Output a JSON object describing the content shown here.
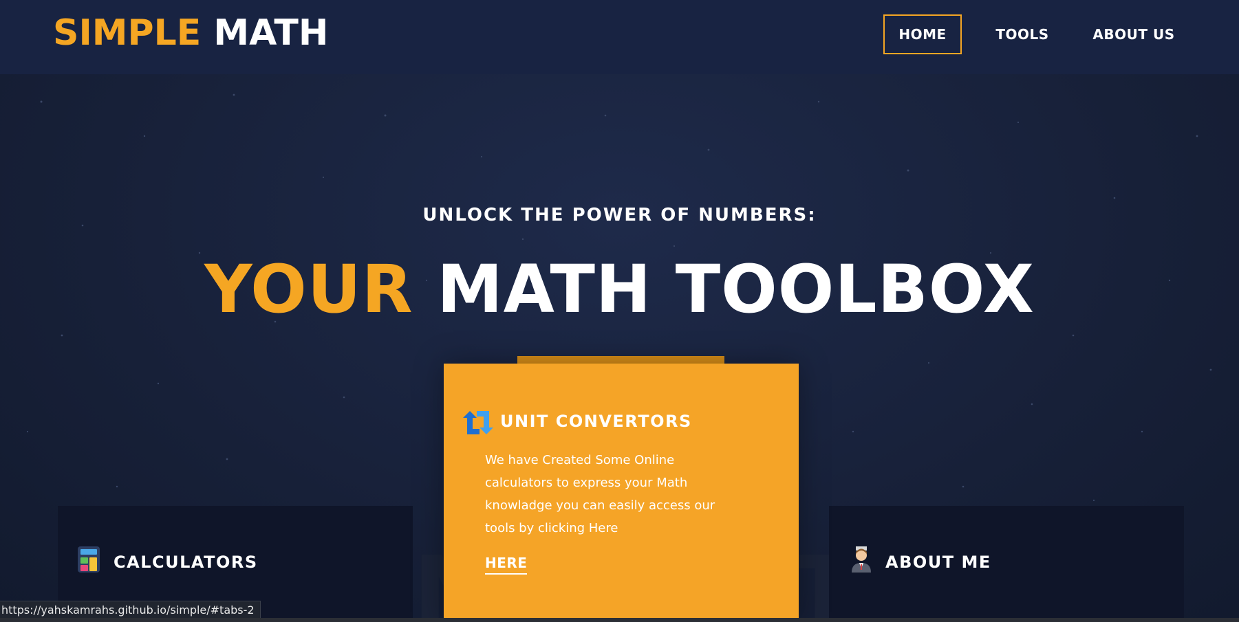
{
  "brand": {
    "part1": "SIMPLE",
    "part2": "MATH"
  },
  "nav": {
    "home": "HOME",
    "tools": "TOOLS",
    "about": "ABOUT US",
    "active": "HOME"
  },
  "hero": {
    "subtitle": "UNLOCK THE POWER OF NUMBERS:",
    "title_accent": "YOUR",
    "title_rest": "MATH TOOLBOX"
  },
  "cards": {
    "calculators": {
      "title": "CALCULATORS",
      "icon": "calculator-icon"
    },
    "unit_convertors": {
      "title": "UNIT CONVERTORS",
      "icon": "convert-arrows-icon",
      "text": "We have Created Some Online calculators to express your Math knowladge you can easily access our tools by clicking Here",
      "link": "HERE"
    },
    "about_me": {
      "title": "ABOUT ME",
      "icon": "person-avatar-icon"
    }
  },
  "status_bar": {
    "url": "https://yahskamrahs.github.io/simple/#tabs-2"
  },
  "colors": {
    "accent": "#f5a623",
    "background": "#1a2340",
    "card_dark": "#0f1529",
    "card_main": "#f5a427"
  }
}
